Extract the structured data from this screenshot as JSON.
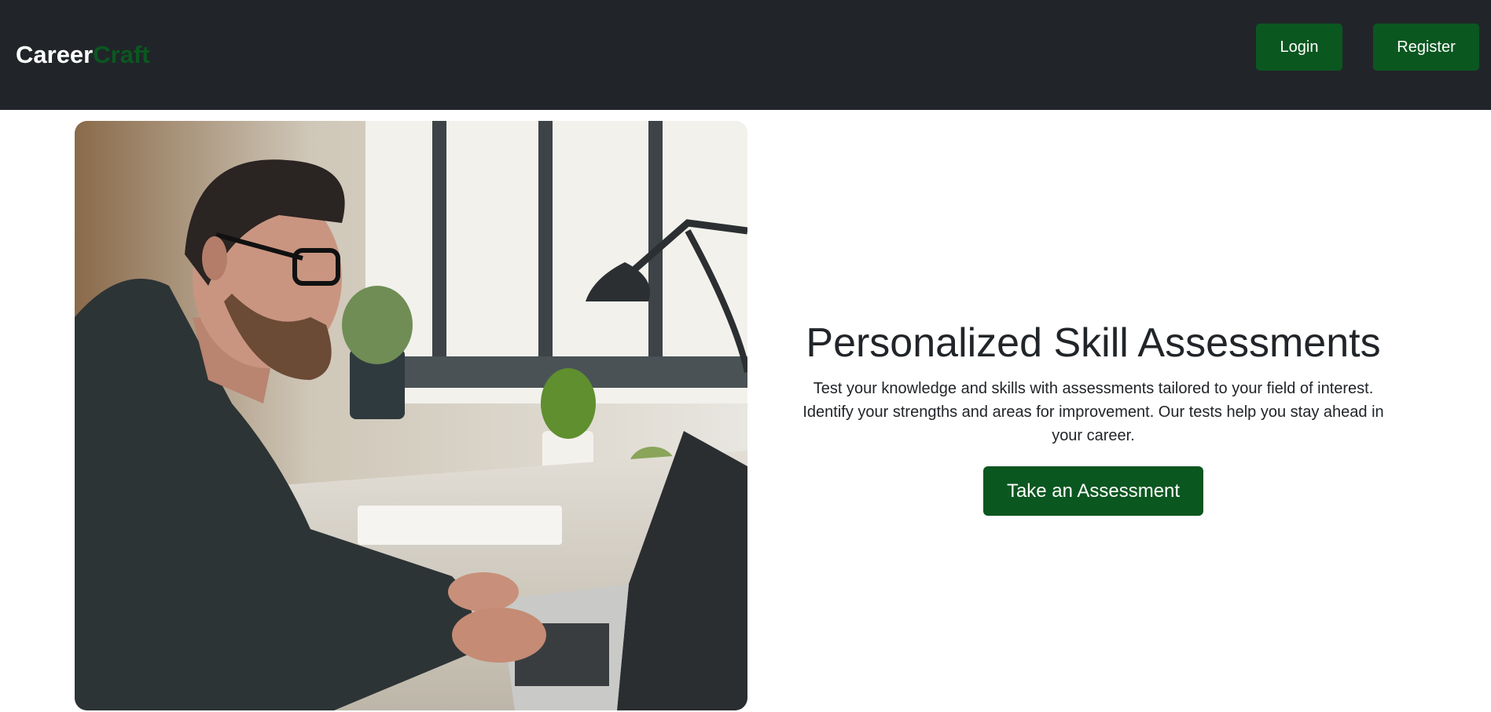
{
  "navbar": {
    "brand_part1": "Career",
    "brand_part2": "Craft",
    "login_label": "Login",
    "register_label": "Register"
  },
  "hero": {
    "image_alt": "Man with glasses typing on a laptop at a desk",
    "title": "Personalized Skill Assessments",
    "description": "Test your knowledge and skills with assessments tailored to your field of interest. Identify your strengths and areas for improvement. Our tests help you stay ahead in your career.",
    "cta_label": "Take an Assessment"
  },
  "colors": {
    "navbar_bg": "#212529",
    "accent_green": "#0b5720",
    "text_dark": "#212529"
  }
}
